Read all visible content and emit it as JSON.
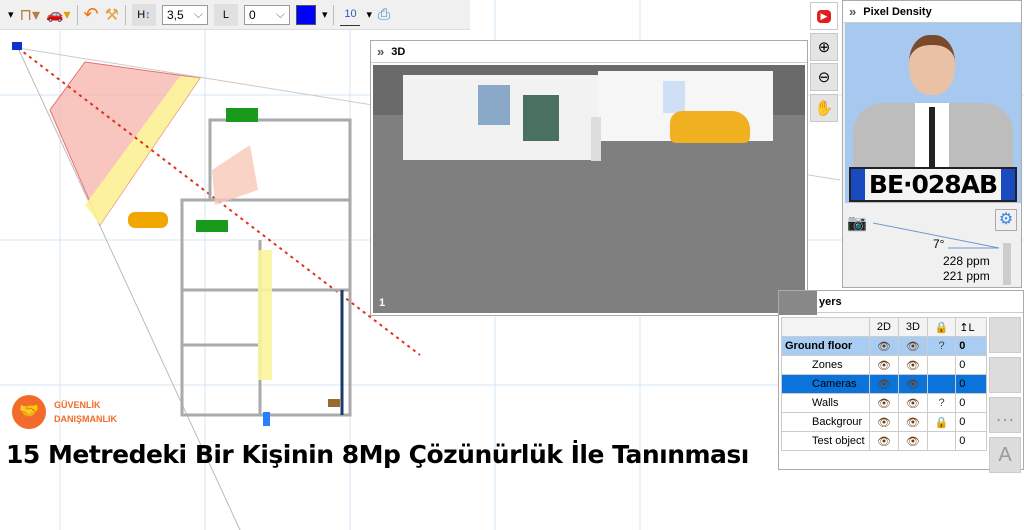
{
  "toolbar": {
    "height_value": "3,5",
    "level_value": "0",
    "height_icon_label": "H",
    "level_icon_label": "L",
    "grid_label": "10",
    "color": "#0000ff"
  },
  "view3d": {
    "title": "3D",
    "view_number": "1"
  },
  "pixel_density": {
    "title": "Pixel Density",
    "plate": "BE·028AB",
    "angle": "7°",
    "ppm_1": "228 ppm",
    "ppm_2": "221 ppm"
  },
  "layers": {
    "title": "Layers",
    "title_visible": "yers",
    "columns": [
      "",
      "2D",
      "3D",
      "lock",
      "L"
    ],
    "rows": [
      {
        "name": "Ground floor",
        "v2d": true,
        "v3d": true,
        "lock": "?",
        "level": "0",
        "style": "floor"
      },
      {
        "name": "Zones",
        "v2d": true,
        "v3d": true,
        "lock": "",
        "level": "0",
        "style": ""
      },
      {
        "name": "Cameras",
        "v2d": true,
        "v3d": true,
        "lock": "",
        "level": "0",
        "style": "selected"
      },
      {
        "name": "Walls",
        "v2d": true,
        "v3d": true,
        "lock": "?",
        "level": "0",
        "style": ""
      },
      {
        "name": "Backgrour",
        "v2d": true,
        "v3d": true,
        "lock": "🔒",
        "level": "0",
        "style": ""
      },
      {
        "name": "Test object",
        "v2d": true,
        "v3d": true,
        "lock": "",
        "level": "0",
        "style": ""
      }
    ]
  },
  "logo": {
    "line1": "GÜVENLİK",
    "line2": "DANIŞMANLIK",
    "color": "#f26b2a"
  },
  "caption": "15 Metredeki Bir Kişinin 8Mp Çözünürlük İle Tanınması"
}
